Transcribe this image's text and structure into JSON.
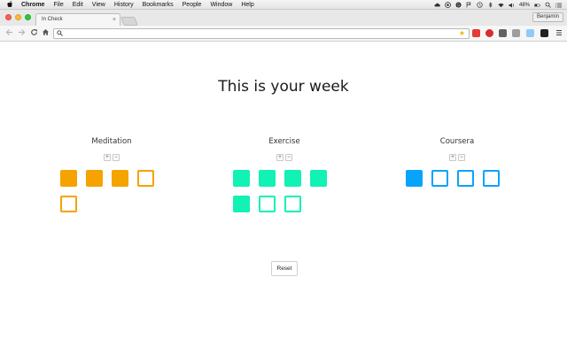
{
  "menubar": {
    "app_name": "Chrome",
    "items": [
      "File",
      "Edit",
      "View",
      "History",
      "Bookmarks",
      "People",
      "Window",
      "Help"
    ],
    "battery": "48%",
    "icons": [
      "bluetooth-icon",
      "wifi-icon",
      "battery-icon"
    ]
  },
  "browser": {
    "tab_title": "In Check",
    "profile_name": "Benjamin",
    "url": "",
    "colors": {
      "tab_bg": "#f6f6f6",
      "strip_bg": "#e8e8e8"
    }
  },
  "page": {
    "title": "This is your week",
    "reset_label": "Reset",
    "plus_label": "+",
    "minus_label": "−",
    "habits": [
      {
        "name": "Meditation",
        "color": "#f5a300",
        "goal": 5,
        "done": 3
      },
      {
        "name": "Exercise",
        "color": "#11f2b4",
        "goal": 7,
        "done": 5
      },
      {
        "name": "Coursera",
        "color": "#08a4fb",
        "goal": 4,
        "done": 1
      }
    ]
  }
}
